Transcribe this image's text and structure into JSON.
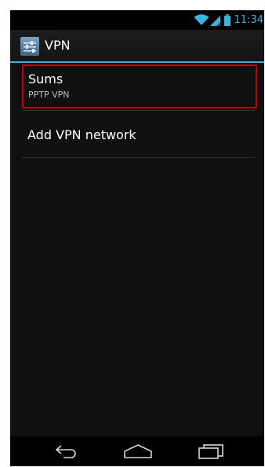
{
  "status_bar": {
    "time": "11:34",
    "icons": [
      "wifi-icon",
      "cell-signal-icon",
      "battery-icon"
    ]
  },
  "action_bar": {
    "title": "VPN",
    "icon": "settings-icon"
  },
  "vpn_list": [
    {
      "name": "Sums",
      "type": "PPTP VPN"
    }
  ],
  "add_vpn": {
    "label": "Add VPN network"
  },
  "nav_bar": {
    "buttons": [
      "back-icon",
      "home-icon",
      "recent-apps-icon"
    ]
  },
  "colors": {
    "accent": "#33b5e5",
    "selection_border": "#cc0000",
    "background": "#101010"
  }
}
